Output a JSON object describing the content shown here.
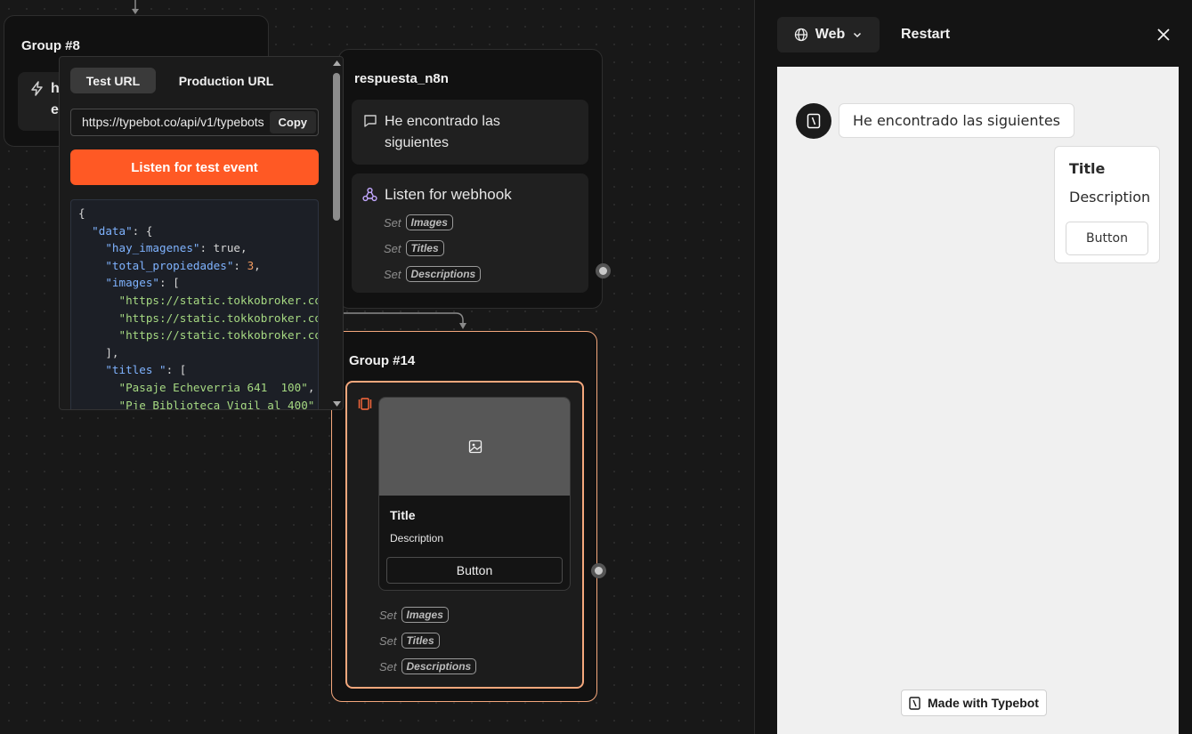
{
  "canvas": {
    "group8": {
      "title": "Group #8",
      "block_text_line1": "h",
      "block_text_line2": "e"
    },
    "webhook_popover": {
      "tab_test": "Test URL",
      "tab_production": "Production URL",
      "url_value": "https://typebot.co/api/v1/typebots",
      "copy_label": "Copy",
      "listen_label": "Listen for test event"
    },
    "respuesta": {
      "title": "respuesta_n8n",
      "text_block": "He encontrado las siguientes",
      "webhook_label": "Listen for webhook",
      "set_word": "Set",
      "vars": [
        "Images",
        "Titles",
        "Descriptions"
      ]
    },
    "group14": {
      "title": "Group #14",
      "card_title": "Title",
      "card_description": "Description",
      "card_button": "Button",
      "set_word": "Set",
      "vars": [
        "Images",
        "Titles",
        "Descriptions"
      ]
    }
  },
  "preview": {
    "platform_label": "Web",
    "restart_label": "Restart",
    "bot_message": "He encontrado las siguientes",
    "card_title": "Title",
    "card_description": "Description",
    "card_button": "Button",
    "branding": "Made with Typebot"
  },
  "colors": {
    "accent": "#ff5924",
    "group_selected_border": "#f4a77c",
    "canvas_bg": "#181818",
    "preview_bg": "#f0f0f0"
  },
  "icons": [
    "arrow-down-icon",
    "lightning-icon",
    "chat-bubble-icon",
    "webhook-icon",
    "carousel-icon",
    "image-icon",
    "globe-icon",
    "chevron-down-icon",
    "close-icon",
    "typebot-logo-icon"
  ]
}
